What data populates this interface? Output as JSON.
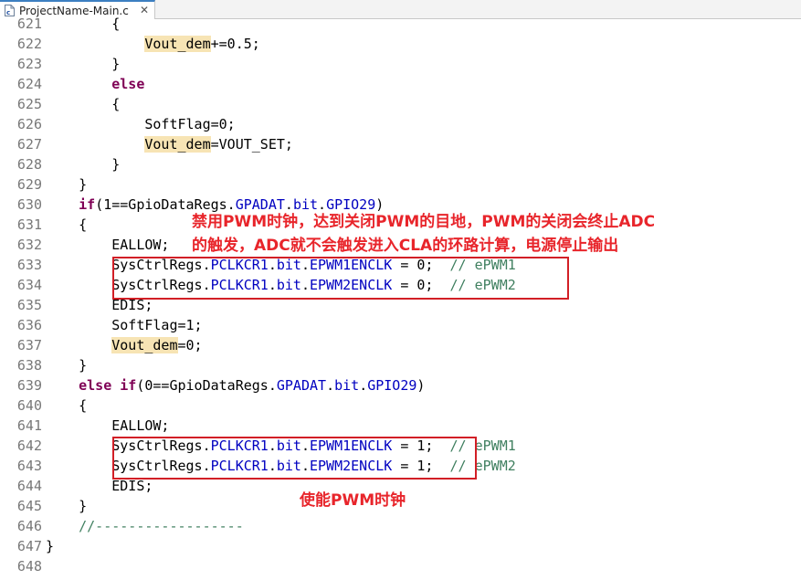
{
  "tab": {
    "title": "ProjectName-Main.c",
    "close": "✕"
  },
  "lines": [
    {
      "n": "621",
      "parts": [
        [
          "t",
          "        {"
        ]
      ]
    },
    {
      "n": "622",
      "parts": [
        [
          "t",
          "            "
        ],
        [
          "hl",
          "Vout_dem"
        ],
        [
          "t",
          "+=0.5;"
        ]
      ]
    },
    {
      "n": "623",
      "parts": [
        [
          "t",
          "        }"
        ]
      ]
    },
    {
      "n": "624",
      "parts": [
        [
          "t",
          "        "
        ],
        [
          "kw",
          "else"
        ]
      ]
    },
    {
      "n": "625",
      "parts": [
        [
          "t",
          "        {"
        ]
      ]
    },
    {
      "n": "626",
      "parts": [
        [
          "t",
          "            SoftFlag=0;"
        ]
      ]
    },
    {
      "n": "627",
      "parts": [
        [
          "t",
          "            "
        ],
        [
          "hl",
          "Vout_dem"
        ],
        [
          "t",
          "=VOUT_SET;"
        ]
      ]
    },
    {
      "n": "628",
      "parts": [
        [
          "t",
          "        }"
        ]
      ]
    },
    {
      "n": "629",
      "parts": [
        [
          "t",
          "    }"
        ]
      ]
    },
    {
      "n": "630",
      "parts": [
        [
          "t",
          "    "
        ],
        [
          "kw",
          "if"
        ],
        [
          "t",
          "(1==GpioDataRegs."
        ],
        [
          "f",
          "GPADAT"
        ],
        [
          "t",
          "."
        ],
        [
          "f",
          "bit"
        ],
        [
          "t",
          "."
        ],
        [
          "f",
          "GPIO29"
        ],
        [
          "t",
          ")"
        ]
      ]
    },
    {
      "n": "631",
      "parts": [
        [
          "t",
          "    {"
        ]
      ]
    },
    {
      "n": "632",
      "parts": [
        [
          "t",
          "        EALLOW;"
        ]
      ]
    },
    {
      "n": "633",
      "parts": [
        [
          "t",
          "        SysCtrlRegs."
        ],
        [
          "f",
          "PCLKCR1"
        ],
        [
          "t",
          "."
        ],
        [
          "f",
          "bit"
        ],
        [
          "t",
          "."
        ],
        [
          "f",
          "EPWM1ENCLK"
        ],
        [
          "t",
          " = 0;  "
        ],
        [
          "c",
          "// ePWM1"
        ]
      ]
    },
    {
      "n": "634",
      "parts": [
        [
          "t",
          "        SysCtrlRegs."
        ],
        [
          "f",
          "PCLKCR1"
        ],
        [
          "t",
          "."
        ],
        [
          "f",
          "bit"
        ],
        [
          "t",
          "."
        ],
        [
          "f",
          "EPWM2ENCLK"
        ],
        [
          "t",
          " = 0;  "
        ],
        [
          "c",
          "// ePWM2"
        ]
      ]
    },
    {
      "n": "635",
      "parts": [
        [
          "t",
          "        EDIS;"
        ]
      ]
    },
    {
      "n": "636",
      "parts": [
        [
          "t",
          "        SoftFlag=1;"
        ]
      ]
    },
    {
      "n": "637",
      "parts": [
        [
          "t",
          "        "
        ],
        [
          "hl",
          "Vout_dem"
        ],
        [
          "t",
          "=0;"
        ]
      ]
    },
    {
      "n": "638",
      "parts": [
        [
          "t",
          "    }"
        ]
      ]
    },
    {
      "n": "639",
      "parts": [
        [
          "t",
          "    "
        ],
        [
          "kw",
          "else if"
        ],
        [
          "t",
          "(0==GpioDataRegs."
        ],
        [
          "f",
          "GPADAT"
        ],
        [
          "t",
          "."
        ],
        [
          "f",
          "bit"
        ],
        [
          "t",
          "."
        ],
        [
          "f",
          "GPIO29"
        ],
        [
          "t",
          ")"
        ]
      ]
    },
    {
      "n": "640",
      "parts": [
        [
          "t",
          "    {"
        ]
      ]
    },
    {
      "n": "641",
      "parts": [
        [
          "t",
          "        EALLOW;"
        ]
      ]
    },
    {
      "n": "642",
      "parts": [
        [
          "t",
          "        SysCtrlRegs."
        ],
        [
          "f",
          "PCLKCR1"
        ],
        [
          "t",
          "."
        ],
        [
          "f",
          "bit"
        ],
        [
          "t",
          "."
        ],
        [
          "f",
          "EPWM1ENCLK"
        ],
        [
          "t",
          " = 1;  "
        ],
        [
          "c",
          "// ePWM1"
        ]
      ]
    },
    {
      "n": "643",
      "parts": [
        [
          "t",
          "        SysCtrlRegs."
        ],
        [
          "f",
          "PCLKCR1"
        ],
        [
          "t",
          "."
        ],
        [
          "f",
          "bit"
        ],
        [
          "t",
          "."
        ],
        [
          "f",
          "EPWM2ENCLK"
        ],
        [
          "t",
          " = 1;  "
        ],
        [
          "c",
          "// ePWM2"
        ]
      ]
    },
    {
      "n": "644",
      "parts": [
        [
          "t",
          "        EDIS;"
        ]
      ]
    },
    {
      "n": "645",
      "parts": [
        [
          "t",
          "    }"
        ]
      ]
    },
    {
      "n": "646",
      "parts": [
        [
          "t",
          "    "
        ],
        [
          "c",
          "//------------------"
        ]
      ]
    },
    {
      "n": "647",
      "parts": [
        [
          "t",
          "}"
        ]
      ]
    },
    {
      "n": "648",
      "parts": [
        [
          "t",
          ""
        ]
      ]
    }
  ],
  "annotations": {
    "disable": "禁用PWM时钟，达到关闭PWM的目地，PWM的关闭会终止ADC\n的触发，ADC就不会触发进入CLA的环路计算，电源停止输出",
    "enable": "使能PWM时钟"
  },
  "colors": {
    "keyword": "#7f0055",
    "field": "#0000c0",
    "comment": "#3f7f5f",
    "highlight": "#f7e4b4",
    "annotation": "#e8252b"
  }
}
